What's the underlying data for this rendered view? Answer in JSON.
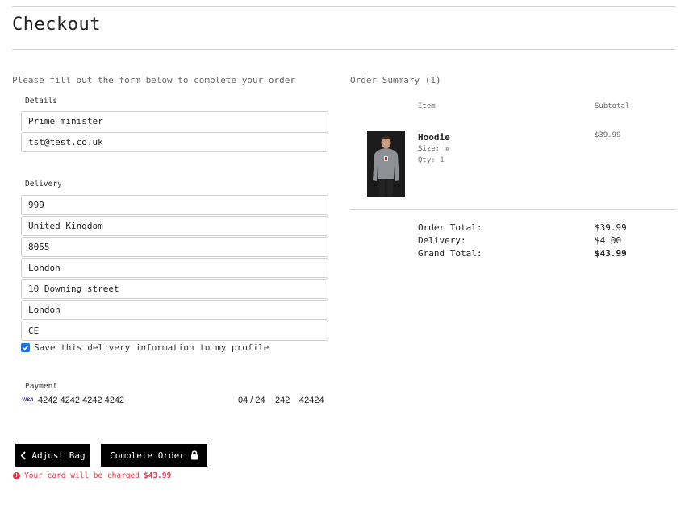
{
  "page": {
    "title": "Checkout"
  },
  "form": {
    "intro": "Please fill out the form below to complete your order",
    "details": {
      "label": "Details",
      "full_name": "Prime minister",
      "email": "tst@test.co.uk"
    },
    "delivery": {
      "label": "Delivery",
      "phone_number": "999",
      "country": "United Kingdom",
      "postcode": "8055",
      "town_or_city": "London",
      "street_address": "10 Downing street",
      "county": "London",
      "street_address_2": "CE"
    },
    "save_info": {
      "checked": true,
      "label": "Save this delivery information to my profile"
    },
    "payment": {
      "label": "Payment",
      "card_brand": "VISA",
      "card_number": "4242 4242 4242 4242",
      "expiry": "04 / 24",
      "cvc": "242",
      "postal": "42424"
    }
  },
  "buttons": {
    "adjust_bag": "Adjust Bag",
    "complete_order": "Complete Order"
  },
  "charge_notice": {
    "text": "Your card will be charged",
    "amount": "$43.99"
  },
  "summary": {
    "title": "Order Summary (1)",
    "columns": {
      "item": "Item",
      "subtotal": "Subtotal"
    },
    "items": [
      {
        "name": "Hoodie",
        "size": "Size: m",
        "qty": "Qty: 1",
        "subtotal": "$39.99"
      }
    ],
    "totals": {
      "order_total_label": "Order Total:",
      "order_total": "$39.99",
      "delivery_label": "Delivery:",
      "delivery": "$4.00",
      "grand_total_label": "Grand Total:",
      "grand_total": "$43.99"
    }
  },
  "colors": {
    "error": "#dc3545",
    "checkbox": "#1a73e8",
    "button": "#000000"
  }
}
